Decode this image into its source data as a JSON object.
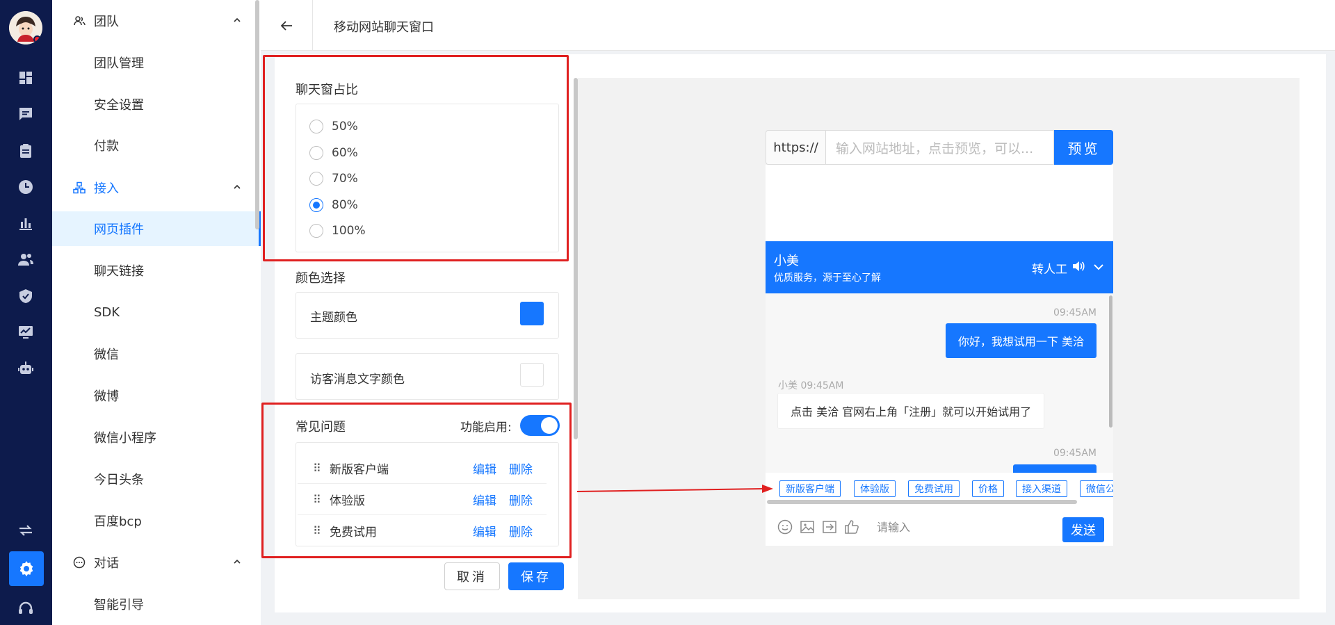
{
  "colors": {
    "accent": "#1677ff",
    "rail": "#0d1b4c",
    "annotation": "#e02020"
  },
  "rail": {
    "icons": [
      "dashboard-icon",
      "chat-icon",
      "clipboard-icon",
      "clock-icon",
      "bar-chart-icon",
      "users-icon",
      "shield-icon",
      "monitor-chart-icon",
      "robot-icon",
      "swap-icon",
      "settings-icon",
      "support-icon"
    ],
    "active": "settings-icon"
  },
  "menu": {
    "group_team": "团队",
    "team_items": [
      "团队管理",
      "安全设置",
      "付款"
    ],
    "group_access": "接入",
    "access_items": [
      "网页插件",
      "聊天链接",
      "SDK",
      "微信",
      "微博",
      "微信小程序",
      "今日头条",
      "百度bcp"
    ],
    "group_dialog": "对话",
    "dialog_items": [
      "智能引导"
    ]
  },
  "header": {
    "title": "移动网站聊天窗口"
  },
  "settings": {
    "ratio_title": "聊天窗占比",
    "ratio_options": [
      "50%",
      "60%",
      "70%",
      "80%",
      "100%"
    ],
    "ratio_selected": "80%",
    "color_title": "颜色选择",
    "theme_color_label": "主题颜色",
    "theme_color": "#1677ff",
    "visitor_text_color_label": "访客消息文字颜色",
    "visitor_text_color": "#ffffff",
    "faq_title": "常见问题",
    "faq_enable_label": "功能启用:",
    "faq_enabled": true,
    "faq_items": [
      "新版客户端",
      "体验版",
      "免费试用"
    ],
    "edit_label": "编辑",
    "delete_label": "删除",
    "cancel_label": "取消",
    "save_label": "保存"
  },
  "preview": {
    "url_prefix": "https://",
    "url_placeholder": "输入网站地址，点击预览，可以...",
    "preview_button": "预览",
    "agent_name": "小美",
    "agent_tagline": "优质服务，源于至心了解",
    "transfer_label": "转人工",
    "messages": [
      {
        "time": "09:45AM",
        "text": "你好，我想试用一下 美洽"
      },
      {
        "time": "小美 09:45AM",
        "text": "点击 美洽 官网右上角「注册」就可以开始试用了"
      },
      {
        "time": "09:45AM"
      }
    ],
    "chips": [
      "新版客户端",
      "体验版",
      "免费试用",
      "价格",
      "接入渠道",
      "微信公"
    ],
    "input_placeholder": "请输入",
    "send_label": "发送"
  }
}
